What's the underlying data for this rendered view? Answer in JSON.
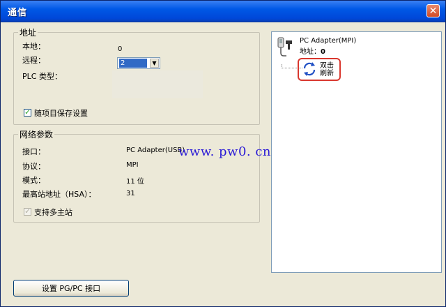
{
  "window": {
    "title": "通信",
    "close_glyph": "✕"
  },
  "address_group": {
    "legend": "地址",
    "local_label": "本地：",
    "local_value": "0",
    "remote_label": "远程：",
    "remote_value": "2",
    "plc_type_label": "PLC 类型：",
    "save_with_project_label": "随项目保存设置"
  },
  "network_group": {
    "legend": "网络参数",
    "rows": [
      {
        "label": "接口：",
        "value": "PC Adapter(USB)"
      },
      {
        "label": "协议：",
        "value": "MPI"
      },
      {
        "label": "模式：",
        "value": "11 位"
      },
      {
        "label": "最高站地址（HSA）：",
        "value": "31"
      }
    ],
    "multi_master_label": "支持多主站"
  },
  "tree": {
    "node_label": "PC Adapter(MPI)",
    "address_label": "地址：",
    "address_value": "0",
    "refresh_label_1": "双击",
    "refresh_label_2": "刷新"
  },
  "buttons": {
    "set_pgpc_label": "设置 PG/PC 接口"
  },
  "watermark": "www. pw0. cn",
  "colors": {
    "titlebar": "#0058e6",
    "highlight_ring": "#d9372e",
    "watermark": "#2a1ad6",
    "refresh_icon": "#1f4fc4"
  }
}
